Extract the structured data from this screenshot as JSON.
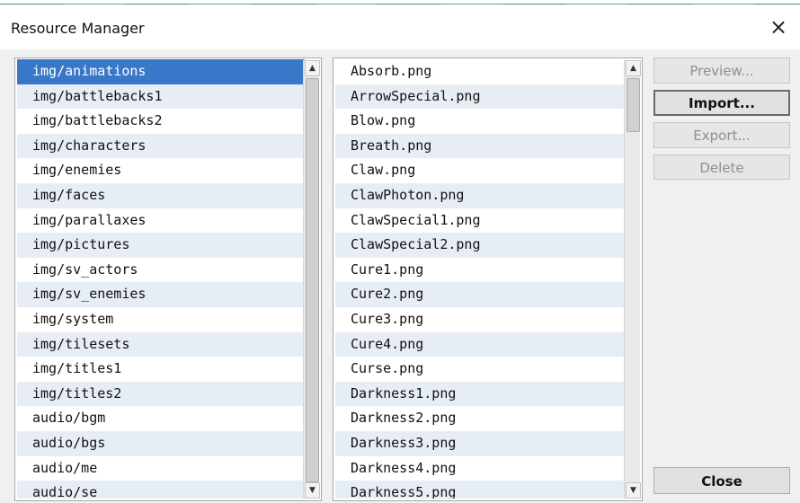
{
  "window": {
    "title": "Resource Manager",
    "close_glyph": "×"
  },
  "folders": {
    "selected_index": 0,
    "items": [
      "img/animations",
      "img/battlebacks1",
      "img/battlebacks2",
      "img/characters",
      "img/enemies",
      "img/faces",
      "img/parallaxes",
      "img/pictures",
      "img/sv_actors",
      "img/sv_enemies",
      "img/system",
      "img/tilesets",
      "img/titles1",
      "img/titles2",
      "audio/bgm",
      "audio/bgs",
      "audio/me",
      "audio/se"
    ]
  },
  "files": {
    "items": [
      "Absorb.png",
      "ArrowSpecial.png",
      "Blow.png",
      "Breath.png",
      "Claw.png",
      "ClawPhoton.png",
      "ClawSpecial1.png",
      "ClawSpecial2.png",
      "Cure1.png",
      "Cure2.png",
      "Cure3.png",
      "Cure4.png",
      "Curse.png",
      "Darkness1.png",
      "Darkness2.png",
      "Darkness3.png",
      "Darkness4.png",
      "Darkness5.png"
    ]
  },
  "buttons": {
    "preview": "Preview...",
    "import": "Import...",
    "export": "Export...",
    "delete": "Delete",
    "close": "Close"
  },
  "scroll_glyphs": {
    "up": "▲",
    "down": "▼"
  }
}
